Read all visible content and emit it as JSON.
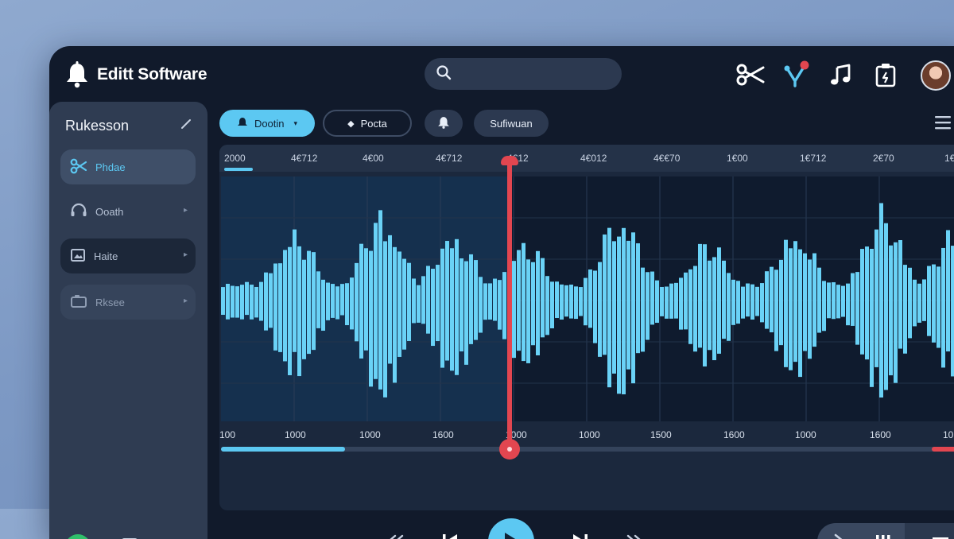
{
  "app": {
    "title": "Editt Software"
  },
  "search": {
    "placeholder": ""
  },
  "toolbar_icons": [
    "scissors-icon",
    "split-icon",
    "music-note-icon",
    "clipboard-icon"
  ],
  "colors": {
    "accent": "#5cc8f2",
    "playhead": "#e24650",
    "notification": "#e24650",
    "window": "#111a2b",
    "sidebar": "#2f3c52"
  },
  "sidebar": {
    "title": "Rukesson",
    "items": [
      {
        "label": "Phdae",
        "icon": "scissors-icon",
        "active": true
      },
      {
        "label": "Ooath",
        "icon": "headset-icon",
        "active": false
      },
      {
        "label": "Haite",
        "icon": "image-icon",
        "active": false
      },
      {
        "label": "Rksee",
        "icon": "video-icon",
        "active": false
      }
    ]
  },
  "chips": [
    {
      "label": "Dootin",
      "icon": "bell-icon",
      "active": true
    },
    {
      "label": "Pocta",
      "icon": "pin-icon",
      "active": false
    },
    {
      "label": "",
      "icon": "bell-icon",
      "active": false
    },
    {
      "label": "Sufiwuan",
      "icon": "",
      "active": false
    }
  ],
  "timeline": {
    "top_ticks": [
      "2000",
      "4€712",
      "4€00",
      "4€712",
      "4€12",
      "4€012",
      "4€€70",
      "1€00",
      "1€712",
      "2€70",
      "1€"
    ],
    "bottom_ticks": [
      "100",
      "1000",
      "1000",
      "1600",
      "1000",
      "1000",
      "1500",
      "1600",
      "1000",
      "1600",
      "10"
    ],
    "playhead_fraction": 0.386,
    "scrub_fill_fraction": 0.165
  }
}
